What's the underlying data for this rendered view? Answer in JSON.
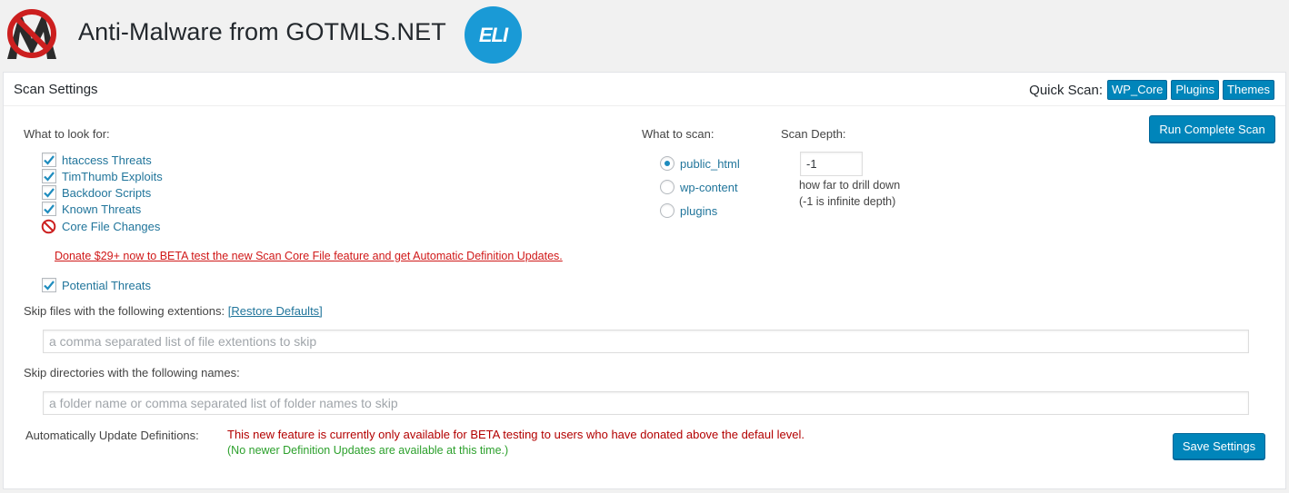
{
  "header": {
    "title": "Anti-Malware from GOTMLS.NET",
    "badge_text": "ELI"
  },
  "panel": {
    "title": "Scan Settings",
    "quick_scan": {
      "label": "Quick Scan:",
      "buttons": [
        "WP_Core",
        "Plugins",
        "Themes"
      ]
    },
    "run_scan_label": "Run Complete Scan",
    "look_for": {
      "label": "What to look for:",
      "options": [
        {
          "label": "htaccess Threats",
          "state": "checked"
        },
        {
          "label": "TimThumb Exploits",
          "state": "checked"
        },
        {
          "label": "Backdoor Scripts",
          "state": "checked"
        },
        {
          "label": "Known Threats",
          "state": "checked"
        },
        {
          "label": "Core File Changes",
          "state": "disabled"
        }
      ],
      "donate_text": "Donate $29+ now to BETA test the new Scan Core File feature and get Automatic Definition Updates.",
      "potential_threats": {
        "label": "Potential Threats",
        "state": "checked"
      }
    },
    "what_to_scan": {
      "label": "What to scan:",
      "options": [
        "public_html",
        "wp-content",
        "plugins"
      ],
      "selected": "public_html"
    },
    "scan_depth": {
      "label": "Scan Depth:",
      "value": "-1",
      "help_line1": "how far to drill down",
      "help_line2": "(-1 is infinite depth)"
    },
    "skip_extensions": {
      "label": "Skip files with the following extentions:",
      "restore_label": "[Restore Defaults]",
      "placeholder": "a comma separated list of file extentions to skip"
    },
    "skip_directories": {
      "label": "Skip directories with the following names:",
      "placeholder": "a folder name or comma separated list of folder names to skip"
    },
    "auto_update": {
      "label": "Automatically Update Definitions:",
      "message": "This new feature is currently only available for BETA testing to users who have donated above the defaul level.",
      "status": "(No newer Definition Updates are available at this time.)"
    },
    "save_label": "Save Settings"
  },
  "colors": {
    "primary_button": "#0085ba",
    "link": "#21759b",
    "error": "#b30000",
    "success": "#2ca02c",
    "badge": "#1a9ad6"
  }
}
